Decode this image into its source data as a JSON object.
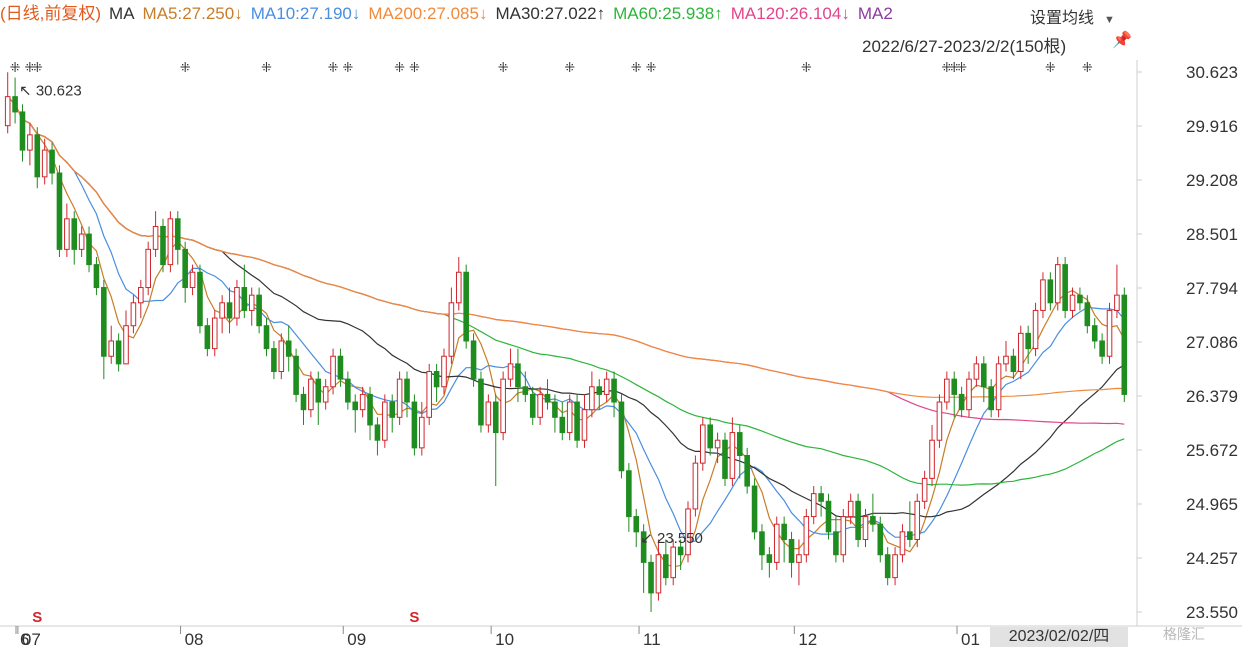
{
  "header": {
    "title": "(日线,前复权)",
    "ma_prefix": "MA",
    "ma_items": [
      {
        "label": "MA5:27.250↓",
        "color": "#c87d29"
      },
      {
        "label": "MA10:27.190↓",
        "color": "#4a8ee0"
      },
      {
        "label": "MA200:27.085↓",
        "color": "#f08a3c"
      },
      {
        "label": "MA30:27.022↑",
        "color": "#333333"
      },
      {
        "label": "MA60:25.938↑",
        "color": "#2db53a"
      },
      {
        "label": "MA120:26.104↓",
        "color": "#e2458b"
      },
      {
        "label": "MA2",
        "color": "#8b3c9e"
      }
    ],
    "settings_label": "设置均线",
    "range_label": "2022/6/27-2023/2/2(150根)",
    "pin_icon": "pin-icon",
    "date_badge": "2023/02/02/四",
    "watermark": "格隆汇"
  },
  "chart_data": {
    "type": "candlestick",
    "up_color": "#d0262c",
    "down_color": "#1e8c1e",
    "ylim": [
      23.55,
      30.623
    ],
    "y_ticks": [
      "30.623",
      "29.916",
      "29.208",
      "28.501",
      "27.794",
      "27.086",
      "26.379",
      "25.672",
      "24.965",
      "24.257",
      "23.550"
    ],
    "x_ticks": [
      {
        "label": "6",
        "index": 0
      },
      {
        "label": "07",
        "index": 3
      },
      {
        "label": "08",
        "index": 25
      },
      {
        "label": "09",
        "index": 47
      },
      {
        "label": "10",
        "index": 67
      },
      {
        "label": "11",
        "index": 87
      },
      {
        "label": "12",
        "index": 108
      },
      {
        "label": "01",
        "index": 130
      }
    ],
    "high_annotation": {
      "label": "30.623",
      "index": 1
    },
    "low_annotation": {
      "label": "23.550",
      "index": 85
    },
    "dividend_markers": [
      {
        "label": "S",
        "index": 4
      },
      {
        "label": "S",
        "index": 55
      }
    ],
    "event_marker_indices": [
      1,
      3,
      4,
      24,
      35,
      44,
      46,
      53,
      55,
      67,
      76,
      85,
      87,
      108,
      127,
      128,
      129,
      141,
      146
    ],
    "candles": [
      [
        29.92,
        30.3,
        30.62,
        29.82
      ],
      [
        30.3,
        30.1,
        30.55,
        29.95
      ],
      [
        30.1,
        29.6,
        30.2,
        29.45
      ],
      [
        29.6,
        29.8,
        29.95,
        29.4
      ],
      [
        29.8,
        29.25,
        29.9,
        29.1
      ],
      [
        29.25,
        29.6,
        29.75,
        29.15
      ],
      [
        29.6,
        29.3,
        29.7,
        29.15
      ],
      [
        29.3,
        28.3,
        29.4,
        28.2
      ],
      [
        28.3,
        28.7,
        28.9,
        28.2
      ],
      [
        28.7,
        28.3,
        28.8,
        28.1
      ],
      [
        28.3,
        28.5,
        28.6,
        28.2
      ],
      [
        28.5,
        28.1,
        28.6,
        28.0
      ],
      [
        28.1,
        27.8,
        28.2,
        27.7
      ],
      [
        27.8,
        26.9,
        27.9,
        26.6
      ],
      [
        26.9,
        27.1,
        27.3,
        26.8
      ],
      [
        27.1,
        26.8,
        27.2,
        26.7
      ],
      [
        26.8,
        27.3,
        27.5,
        26.8
      ],
      [
        27.3,
        27.6,
        27.7,
        27.2
      ],
      [
        27.6,
        27.8,
        27.9,
        27.4
      ],
      [
        27.8,
        28.3,
        28.4,
        27.7
      ],
      [
        28.3,
        28.6,
        28.8,
        28.2
      ],
      [
        28.6,
        28.1,
        28.7,
        28.0
      ],
      [
        28.1,
        28.7,
        28.8,
        28.0
      ],
      [
        28.7,
        28.3,
        28.8,
        28.1
      ],
      [
        28.3,
        27.8,
        28.4,
        27.6
      ],
      [
        27.8,
        28.0,
        28.1,
        27.7
      ],
      [
        28.0,
        27.3,
        28.1,
        27.2
      ],
      [
        27.3,
        27.0,
        27.4,
        26.9
      ],
      [
        27.0,
        27.4,
        27.5,
        26.9
      ],
      [
        27.4,
        27.6,
        27.7,
        27.2
      ],
      [
        27.6,
        27.4,
        27.8,
        27.2
      ],
      [
        27.4,
        27.8,
        27.9,
        27.3
      ],
      [
        27.8,
        27.5,
        28.1,
        27.4
      ],
      [
        27.5,
        27.7,
        27.8,
        27.3
      ],
      [
        27.7,
        27.3,
        27.8,
        27.2
      ],
      [
        27.3,
        27.0,
        27.4,
        26.9
      ],
      [
        27.0,
        26.7,
        27.1,
        26.6
      ],
      [
        26.7,
        27.1,
        27.2,
        26.6
      ],
      [
        27.1,
        26.9,
        27.3,
        26.7
      ],
      [
        26.9,
        26.4,
        27.0,
        26.3
      ],
      [
        26.4,
        26.2,
        26.5,
        26.0
      ],
      [
        26.2,
        26.6,
        26.7,
        26.1
      ],
      [
        26.6,
        26.3,
        26.7,
        26.0
      ],
      [
        26.3,
        26.5,
        26.6,
        26.2
      ],
      [
        26.5,
        26.9,
        27.0,
        26.4
      ],
      [
        26.9,
        26.6,
        27.0,
        26.5
      ],
      [
        26.6,
        26.3,
        26.7,
        26.2
      ],
      [
        26.3,
        26.2,
        26.4,
        25.9
      ],
      [
        26.2,
        26.4,
        26.5,
        26.1
      ],
      [
        26.4,
        26.0,
        26.5,
        25.8
      ],
      [
        26.0,
        25.8,
        26.1,
        25.6
      ],
      [
        25.8,
        26.3,
        26.4,
        25.7
      ],
      [
        26.3,
        26.1,
        26.4,
        25.9
      ],
      [
        26.1,
        26.6,
        26.7,
        26.0
      ],
      [
        26.6,
        26.3,
        26.7,
        26.1
      ],
      [
        26.3,
        25.7,
        26.4,
        25.6
      ],
      [
        25.7,
        26.1,
        26.3,
        25.6
      ],
      [
        26.1,
        26.7,
        26.8,
        26.0
      ],
      [
        26.7,
        26.5,
        26.8,
        26.3
      ],
      [
        26.5,
        26.9,
        27.0,
        26.4
      ],
      [
        26.9,
        27.6,
        27.8,
        26.8
      ],
      [
        27.6,
        28.0,
        28.2,
        27.5
      ],
      [
        28.0,
        27.1,
        28.1,
        27.0
      ],
      [
        27.1,
        26.6,
        27.2,
        26.5
      ],
      [
        26.6,
        26.0,
        26.7,
        25.9
      ],
      [
        26.0,
        26.3,
        26.4,
        25.9
      ],
      [
        26.3,
        25.9,
        26.4,
        25.2
      ],
      [
        25.9,
        26.6,
        26.7,
        25.8
      ],
      [
        26.6,
        26.8,
        27.0,
        26.5
      ],
      [
        26.8,
        26.5,
        27.0,
        26.3
      ],
      [
        26.5,
        26.4,
        26.7,
        26.3
      ],
      [
        26.4,
        26.1,
        26.5,
        26.0
      ],
      [
        26.1,
        26.4,
        26.5,
        26.0
      ],
      [
        26.4,
        26.3,
        26.6,
        26.2
      ],
      [
        26.3,
        26.1,
        26.4,
        25.9
      ],
      [
        26.1,
        25.9,
        26.3,
        25.8
      ],
      [
        25.9,
        26.3,
        26.4,
        25.8
      ],
      [
        26.3,
        25.8,
        26.4,
        25.7
      ],
      [
        25.8,
        26.2,
        26.4,
        25.7
      ],
      [
        26.2,
        26.5,
        26.7,
        26.1
      ],
      [
        26.5,
        26.4,
        26.6,
        26.2
      ],
      [
        26.4,
        26.6,
        26.7,
        26.3
      ],
      [
        26.6,
        26.3,
        26.7,
        26.1
      ],
      [
        26.3,
        25.4,
        26.4,
        25.3
      ],
      [
        25.4,
        24.8,
        25.5,
        24.6
      ],
      [
        24.8,
        24.6,
        24.9,
        24.4
      ],
      [
        24.6,
        24.2,
        24.7,
        23.8
      ],
      [
        24.2,
        23.8,
        24.3,
        23.55
      ],
      [
        23.8,
        24.3,
        24.5,
        23.7
      ],
      [
        24.3,
        24.0,
        24.5,
        23.9
      ],
      [
        24.0,
        24.4,
        24.5,
        23.9
      ],
      [
        24.4,
        24.3,
        24.5,
        24.1
      ],
      [
        24.3,
        24.9,
        25.0,
        24.2
      ],
      [
        24.9,
        25.5,
        25.6,
        24.8
      ],
      [
        25.5,
        26.0,
        26.1,
        25.4
      ],
      [
        26.0,
        25.7,
        26.1,
        25.6
      ],
      [
        25.7,
        25.8,
        25.9,
        25.5
      ],
      [
        25.8,
        25.3,
        25.9,
        25.2
      ],
      [
        25.3,
        25.9,
        26.1,
        25.2
      ],
      [
        25.9,
        25.6,
        26.0,
        25.3
      ],
      [
        25.6,
        25.2,
        25.7,
        25.1
      ],
      [
        25.2,
        24.6,
        25.3,
        24.5
      ],
      [
        24.6,
        24.3,
        24.7,
        24.1
      ],
      [
        24.3,
        24.2,
        24.4,
        24.0
      ],
      [
        24.2,
        24.7,
        24.8,
        24.1
      ],
      [
        24.7,
        24.5,
        24.8,
        24.2
      ],
      [
        24.5,
        24.2,
        24.6,
        24.0
      ],
      [
        24.2,
        24.3,
        24.5,
        23.9
      ],
      [
        24.3,
        24.8,
        24.9,
        24.2
      ],
      [
        24.8,
        25.1,
        25.2,
        24.7
      ],
      [
        25.1,
        25.0,
        25.2,
        24.8
      ],
      [
        25.0,
        24.6,
        25.1,
        24.5
      ],
      [
        24.6,
        24.3,
        24.8,
        24.2
      ],
      [
        24.3,
        24.8,
        24.9,
        24.2
      ],
      [
        24.8,
        25.0,
        25.1,
        24.7
      ],
      [
        25.0,
        24.5,
        25.1,
        24.4
      ],
      [
        24.5,
        24.8,
        24.9,
        24.4
      ],
      [
        24.8,
        24.7,
        25.1,
        24.6
      ],
      [
        24.7,
        24.3,
        24.8,
        24.2
      ],
      [
        24.3,
        24.0,
        24.4,
        23.9
      ],
      [
        24.0,
        24.3,
        24.4,
        23.9
      ],
      [
        24.3,
        24.6,
        24.7,
        24.2
      ],
      [
        24.6,
        24.5,
        25.0,
        24.4
      ],
      [
        24.5,
        25.0,
        25.1,
        24.4
      ],
      [
        25.0,
        25.3,
        25.4,
        24.9
      ],
      [
        25.3,
        25.8,
        26.0,
        25.2
      ],
      [
        25.8,
        26.3,
        26.4,
        25.7
      ],
      [
        26.3,
        26.6,
        26.7,
        26.2
      ],
      [
        26.6,
        26.4,
        26.7,
        26.1
      ],
      [
        26.4,
        26.2,
        26.5,
        26.1
      ],
      [
        26.2,
        26.6,
        26.7,
        26.1
      ],
      [
        26.6,
        26.8,
        26.9,
        26.5
      ],
      [
        26.8,
        26.5,
        26.9,
        26.3
      ],
      [
        26.5,
        26.2,
        26.6,
        26.1
      ],
      [
        26.2,
        26.8,
        26.9,
        26.1
      ],
      [
        26.8,
        26.9,
        27.1,
        26.7
      ],
      [
        26.9,
        26.7,
        27.0,
        26.6
      ],
      [
        26.7,
        27.2,
        27.3,
        26.6
      ],
      [
        27.2,
        27.0,
        27.3,
        26.8
      ],
      [
        27.0,
        27.5,
        27.6,
        26.9
      ],
      [
        27.5,
        27.9,
        28.0,
        27.4
      ],
      [
        27.9,
        27.6,
        28.0,
        27.5
      ],
      [
        27.6,
        28.1,
        28.2,
        27.5
      ],
      [
        28.1,
        27.5,
        28.2,
        27.4
      ],
      [
        27.5,
        27.7,
        27.8,
        27.4
      ],
      [
        27.7,
        27.6,
        27.8,
        27.5
      ],
      [
        27.6,
        27.3,
        27.7,
        27.2
      ],
      [
        27.3,
        27.1,
        27.4,
        27.0
      ],
      [
        27.1,
        26.9,
        27.2,
        26.8
      ],
      [
        26.9,
        27.5,
        27.6,
        26.8
      ],
      [
        27.5,
        27.7,
        28.1,
        27.4
      ],
      [
        27.7,
        26.4,
        27.8,
        26.3
      ]
    ],
    "ma_series": [
      {
        "key": "MA5",
        "period": 5,
        "color": "#c87d29"
      },
      {
        "key": "MA10",
        "period": 10,
        "color": "#4a8ee0"
      },
      {
        "key": "MA30",
        "period": 30,
        "color": "#333333"
      },
      {
        "key": "MA60",
        "period": 60,
        "color": "#2db53a"
      },
      {
        "key": "MA120",
        "period": 120,
        "color": "#e2458b"
      },
      {
        "key": "MA200",
        "period": 200,
        "color": "#f08a3c"
      }
    ]
  }
}
